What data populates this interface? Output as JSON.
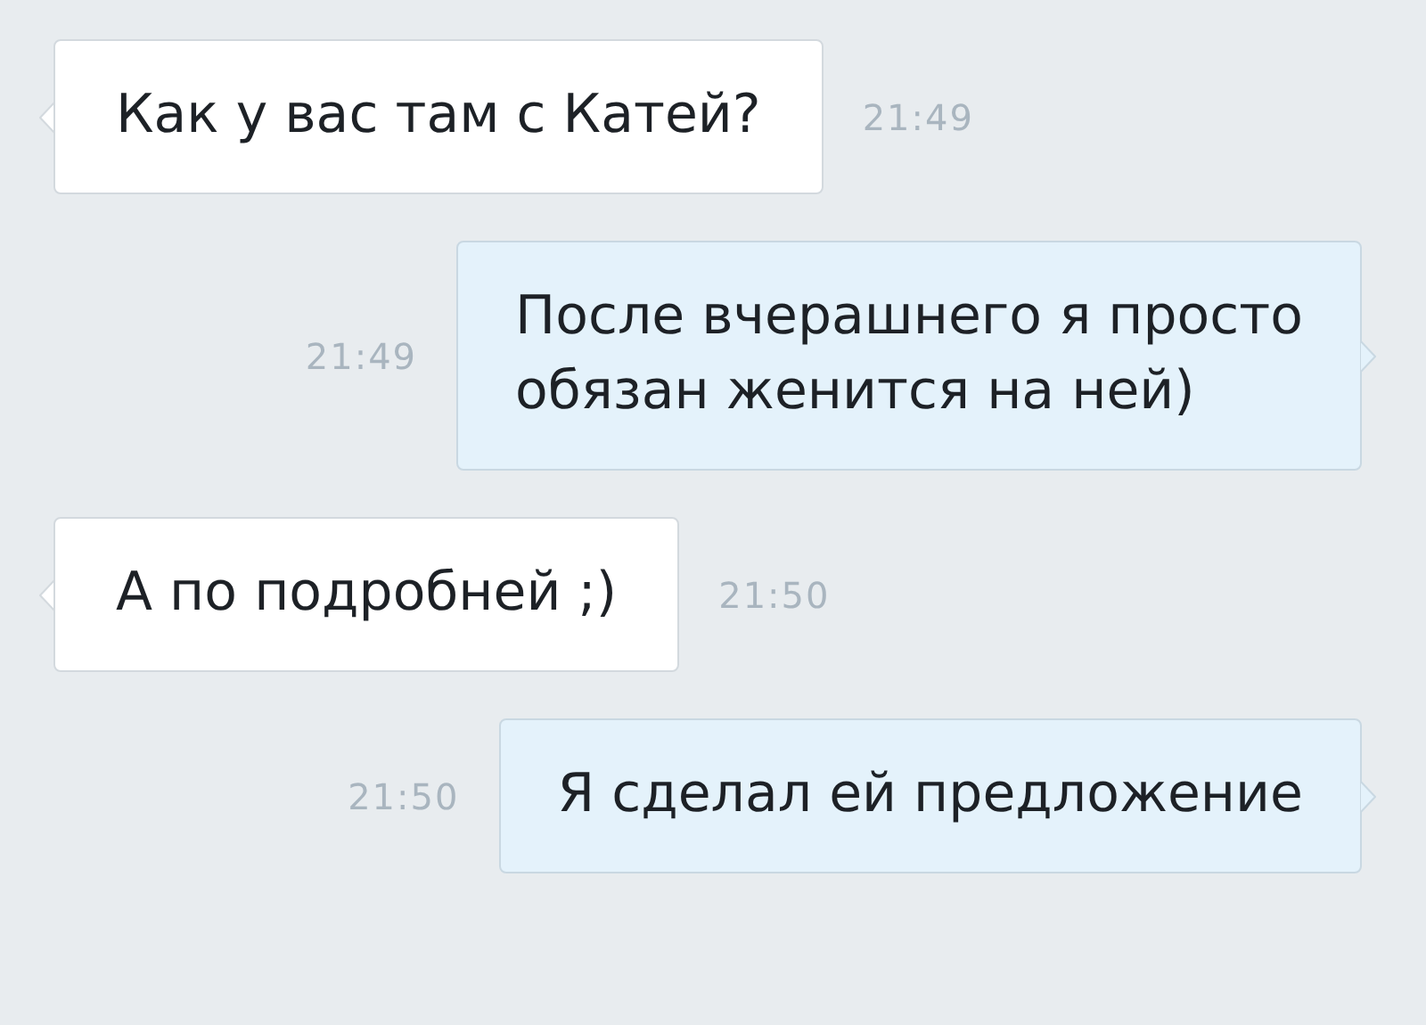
{
  "messages": [
    {
      "sent": false,
      "text": "Как у вас там с Катей?",
      "time": "21:49"
    },
    {
      "sent": true,
      "text": "После вчерашнего я просто\nобязан женится на ней)",
      "time": "21:49"
    },
    {
      "sent": false,
      "text": "А по подробней ;)",
      "time": "21:50"
    },
    {
      "sent": true,
      "text": "Я сделал ей предложение",
      "time": "21:50"
    }
  ]
}
